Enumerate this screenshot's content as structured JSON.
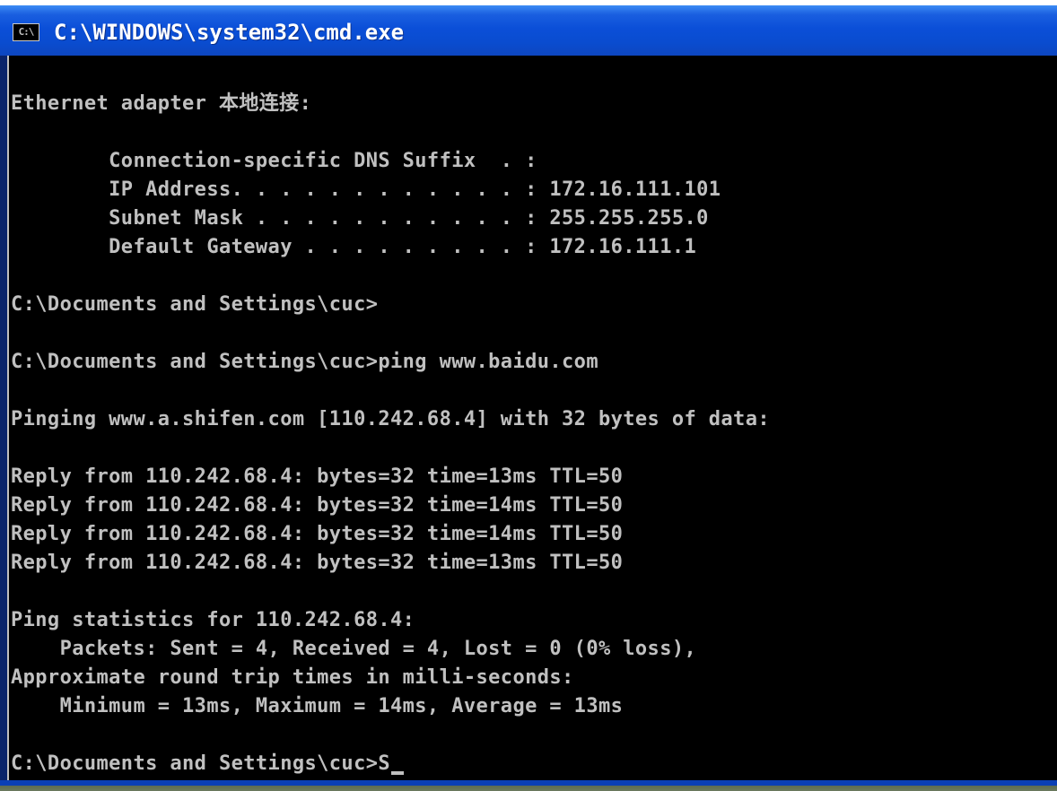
{
  "window": {
    "title": "C:\\WINDOWS\\system32\\cmd.exe",
    "icon_label": "C:\\"
  },
  "console": {
    "lines": [
      "Ethernet adapter 本地连接:",
      "        Connection-specific DNS Suffix  . :",
      "        IP Address. . . . . . . . . . . . : 172.16.111.101",
      "        Subnet Mask . . . . . . . . . . . : 255.255.255.0",
      "        Default Gateway . . . . . . . . . : 172.16.111.1",
      "C:\\Documents and Settings\\cuc>",
      "C:\\Documents and Settings\\cuc>ping www.baidu.com",
      "Pinging www.a.shifen.com [110.242.68.4] with 32 bytes of data:",
      "Reply from 110.242.68.4: bytes=32 time=13ms TTL=50",
      "Reply from 110.242.68.4: bytes=32 time=14ms TTL=50",
      "Reply from 110.242.68.4: bytes=32 time=14ms TTL=50",
      "Reply from 110.242.68.4: bytes=32 time=13ms TTL=50",
      "Ping statistics for 110.242.68.4:",
      "    Packets: Sent = 4, Received = 4, Lost = 0 (0% loss),",
      "Approximate round trip times in milli-seconds:",
      "    Minimum = 13ms, Maximum = 14ms, Average = 13ms",
      "C:\\Documents and Settings\\cuc>S"
    ]
  },
  "colors": {
    "titlebar": "#0b4fd8",
    "console_bg": "#000000",
    "console_text": "#c0c0c0"
  }
}
